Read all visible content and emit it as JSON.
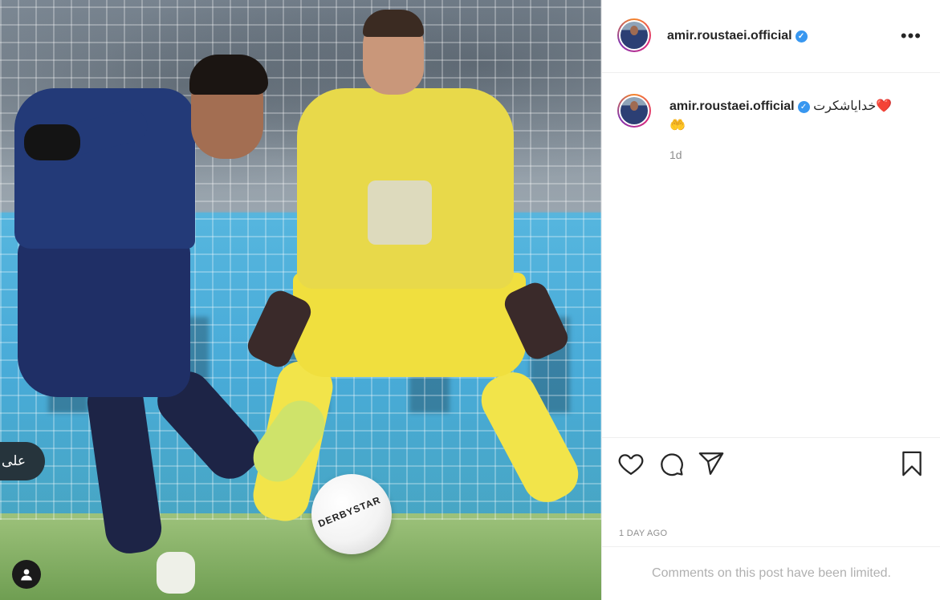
{
  "post": {
    "username": "amir.roustaei.official",
    "verified_icon": "verified-badge-icon",
    "more_icon": "more-options-icon",
    "caption_text": "خدایاشکرت❤️",
    "caption_line2": "🤲",
    "caption_time": "1d",
    "date_label": "1 DAY AGO",
    "comments_notice": "Comments on this post have been limited."
  },
  "photo": {
    "tag_label": "علی",
    "ball_brand": "DERBYSTAR",
    "user_tag_icon": "user-tag-icon"
  },
  "actions": {
    "like_icon": "heart-icon",
    "comment_icon": "comment-icon",
    "share_icon": "share-icon",
    "save_icon": "bookmark-icon"
  },
  "colors": {
    "accent_verified": "#3897f0",
    "text_primary": "#262626",
    "text_secondary": "#8e8e8e"
  }
}
